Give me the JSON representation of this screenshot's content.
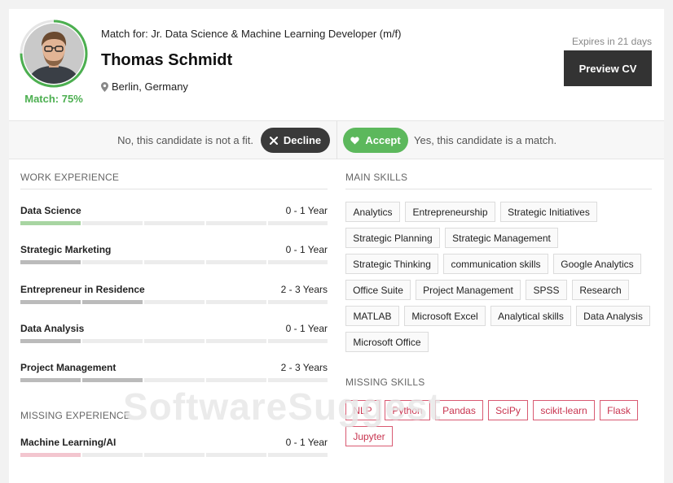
{
  "header": {
    "match_for": "Match for: Jr. Data Science & Machine Learning Developer (m/f)",
    "name": "Thomas Schmidt",
    "location": "Berlin, Germany",
    "match_label": "Match: 75%",
    "match_fraction": 0.75,
    "expires": "Expires in 21 days",
    "preview_button": "Preview CV"
  },
  "actions": {
    "decline_hint": "No, this candidate is not a fit.",
    "decline_button": "Decline",
    "accept_button": "Accept",
    "accept_hint": "Yes, this candidate is a match."
  },
  "work_experience": {
    "title": "WORK EXPERIENCE",
    "items": [
      {
        "label": "Data Science",
        "years": "0 - 1 Year",
        "filled": 1,
        "color": "#a8d5a2"
      },
      {
        "label": "Strategic Marketing",
        "years": "0 - 1 Year",
        "filled": 1,
        "color": "#bbbbbb"
      },
      {
        "label": "Entrepreneur in Residence",
        "years": "2 - 3 Years",
        "filled": 2,
        "color": "#bbbbbb"
      },
      {
        "label": "Data Analysis",
        "years": "0 - 1 Year",
        "filled": 1,
        "color": "#bbbbbb"
      },
      {
        "label": "Project Management",
        "years": "2 - 3 Years",
        "filled": 2,
        "color": "#bbbbbb"
      }
    ]
  },
  "missing_experience": {
    "title": "MISSING EXPERIENCE",
    "items": [
      {
        "label": "Machine Learning/AI",
        "years": "0 - 1 Year",
        "filled": 1,
        "color": "#f3c6cf"
      }
    ]
  },
  "main_skills": {
    "title": "MAIN SKILLS",
    "items": [
      "Analytics",
      "Entrepreneurship",
      "Strategic Initiatives",
      "Strategic Planning",
      "Strategic Management",
      "Strategic Thinking",
      "communication skills",
      "Google Analytics",
      "Office Suite",
      "Project Management",
      "SPSS",
      "Research",
      "MATLAB",
      "Microsoft Excel",
      "Analytical skills",
      "Data Analysis",
      "Microsoft Office"
    ]
  },
  "missing_skills": {
    "title": "MISSING SKILLS",
    "items": [
      "NLP",
      "Python",
      "Pandas",
      "SciPy",
      "scikit-learn",
      "Flask",
      "Jupyter"
    ]
  },
  "watermark": "SoftwareSuggest",
  "colors": {
    "accent_green": "#5cb85c",
    "dark_button": "#333333",
    "missing_red": "#c8344f"
  },
  "icons": {
    "location": "map-pin-icon",
    "decline": "close-icon",
    "accept": "heart-icon"
  }
}
